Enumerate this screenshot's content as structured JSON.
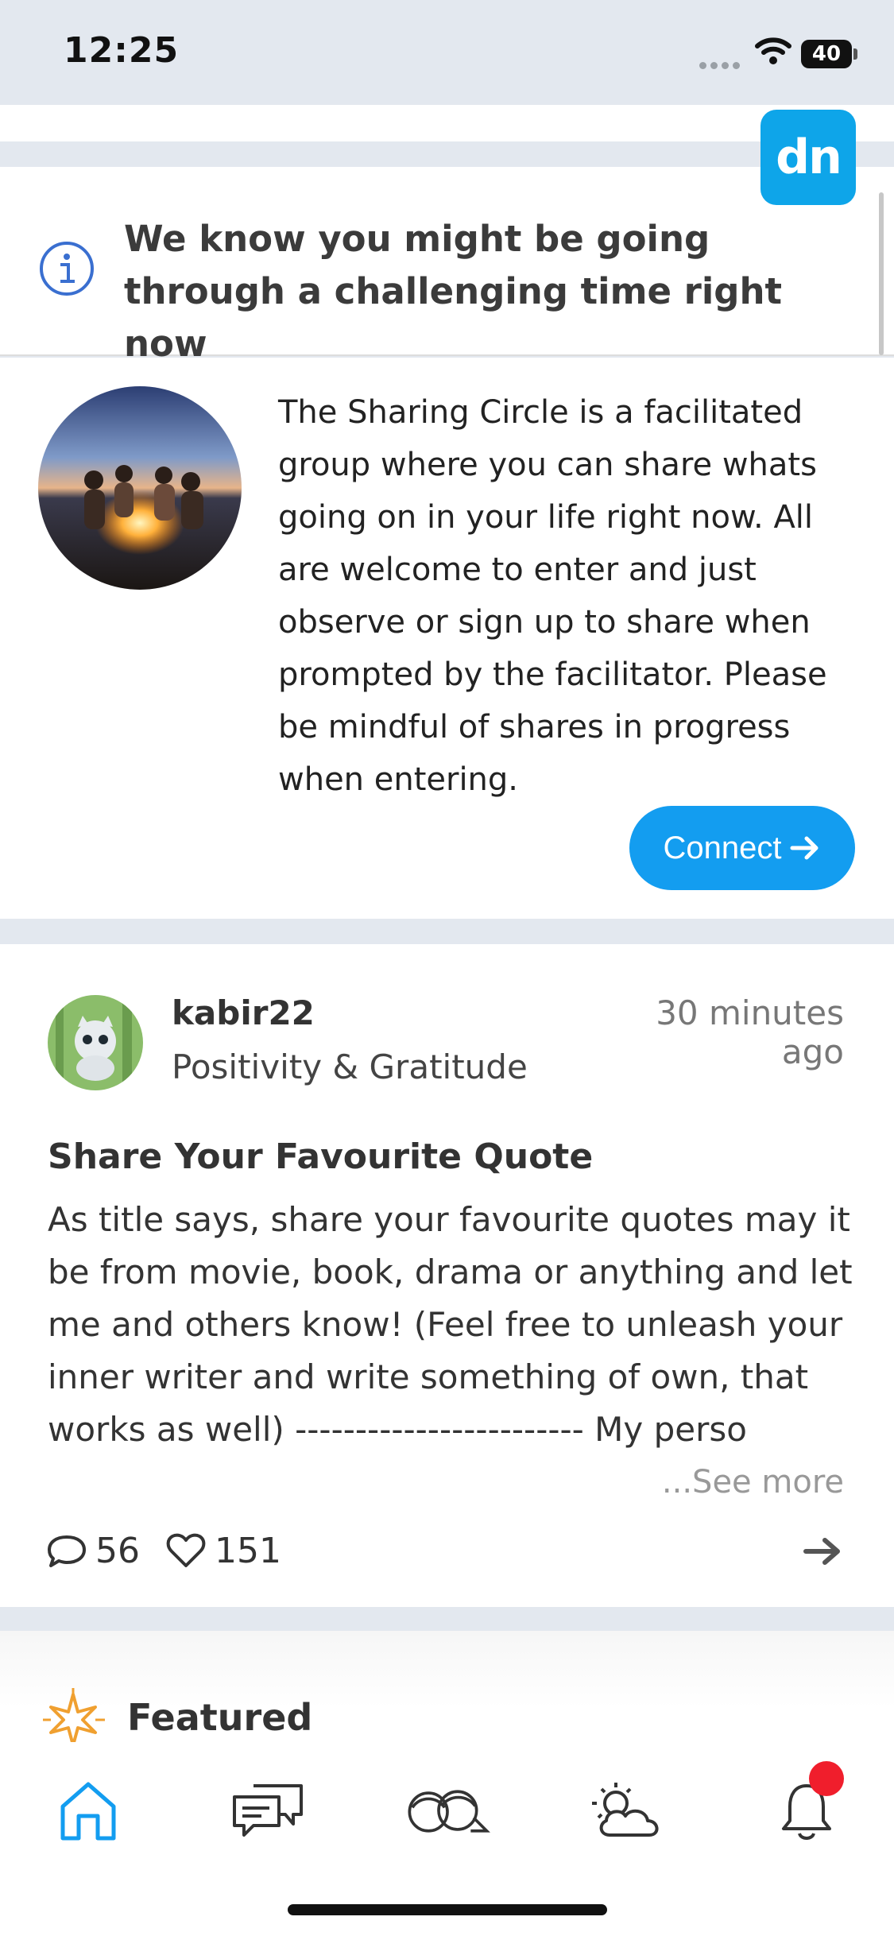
{
  "status_bar": {
    "time": "12:25",
    "battery": "40"
  },
  "badge_logo": "dn",
  "info_card": {
    "message": "We know you might be going through a challenging time right now"
  },
  "sharing_circle": {
    "description": "The Sharing Circle is a facilitated group where you can share whats going on in your life right now. All are welcome to enter and just observe or sign up to share when prompted by the facilitator. Please be mindful of shares in progress when entering.",
    "connect_label": "Connect"
  },
  "post": {
    "username": "kabir22",
    "category": "Positivity & Gratitude",
    "time": "30 minutes ago",
    "title": "Share Your Favourite Quote",
    "body": "As title says, share your favourite quotes may it be from movie, book, drama or anything and let me and others know! (Feel free to unleash your inner writer and write something of own, that works as well) ------------------------ My perso",
    "see_more": "...See more",
    "comments": "56",
    "likes": "151"
  },
  "featured": {
    "label": "Featured"
  },
  "tabbar": {
    "items": [
      {
        "icon": "home-icon",
        "active": true
      },
      {
        "icon": "chat-icon",
        "active": false
      },
      {
        "icon": "community-icon",
        "active": false
      },
      {
        "icon": "weather-icon",
        "active": false
      },
      {
        "icon": "bell-icon",
        "active": false
      }
    ]
  },
  "colors": {
    "accent": "#139df0",
    "badge": "#f01e2c",
    "home_active": "#139df0"
  }
}
